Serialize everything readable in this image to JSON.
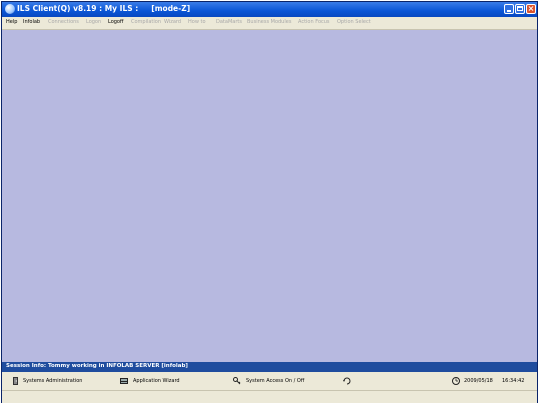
{
  "window": {
    "title": "ILS Client(Q) v8.19 : My ILS :     [mode-Z]"
  },
  "menu": {
    "items": [
      {
        "label": "Help",
        "enabled": true
      },
      {
        "label": "Infolab",
        "enabled": true
      },
      {
        "label": "Connections",
        "enabled": false
      },
      {
        "label": "Logon",
        "enabled": false
      },
      {
        "label": "Logoff",
        "enabled": true
      },
      {
        "label": "Compilation",
        "enabled": false
      },
      {
        "label": "Wizard",
        "enabled": false
      },
      {
        "label": "How to",
        "enabled": false
      },
      {
        "label": "DataMarts",
        "enabled": false
      },
      {
        "label": "Business Modules",
        "enabled": false
      },
      {
        "label": "Action Focus",
        "enabled": false
      },
      {
        "label": "Option Select",
        "enabled": false
      }
    ]
  },
  "session": {
    "info": "Session Info: Tommy working in INFOLAB SERVER  [infolab]"
  },
  "status": {
    "sysadmin": "Systems Administration",
    "wizard": "Application Wizard",
    "access": "System Access On / Off",
    "date": "2009/05/18",
    "time": "16:34:42"
  },
  "colors": {
    "workspace": "#b7b9e0",
    "session_bar": "#1f4c9e",
    "titlebar": "#0a55d6"
  }
}
